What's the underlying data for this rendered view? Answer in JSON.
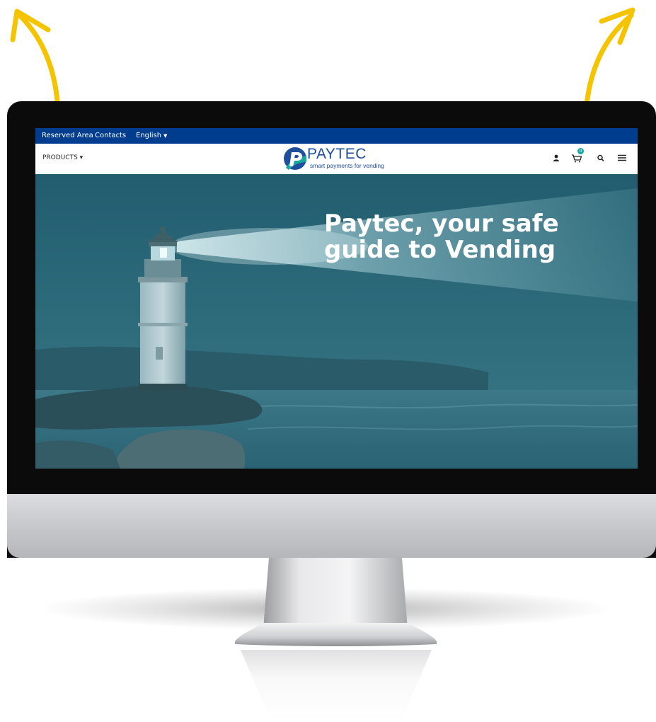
{
  "colors": {
    "accent_arrow": "#f5c400",
    "topbar_bg": "#003d8f",
    "brand_blue": "#1f4e9c",
    "brand_teal": "#1aa6a0",
    "hero_overlay": "#2d6a7a"
  },
  "topbar": {
    "reserved_area": "Reserved Area",
    "contacts": "Contacts",
    "language": "English",
    "language_caret": "▼"
  },
  "navbar": {
    "products_label": "PRODUCTS",
    "products_caret": "▾",
    "logo_text": "PAYTEC",
    "logo_tagline": "smart payments for vending",
    "cart_count": "0",
    "icons": [
      "user-icon",
      "cart-icon",
      "search-icon",
      "menu-icon"
    ]
  },
  "hero": {
    "title_line1": "Paytec, your safe",
    "title_line2": "guide to Vending",
    "image": "lighthouse-at-sea"
  }
}
